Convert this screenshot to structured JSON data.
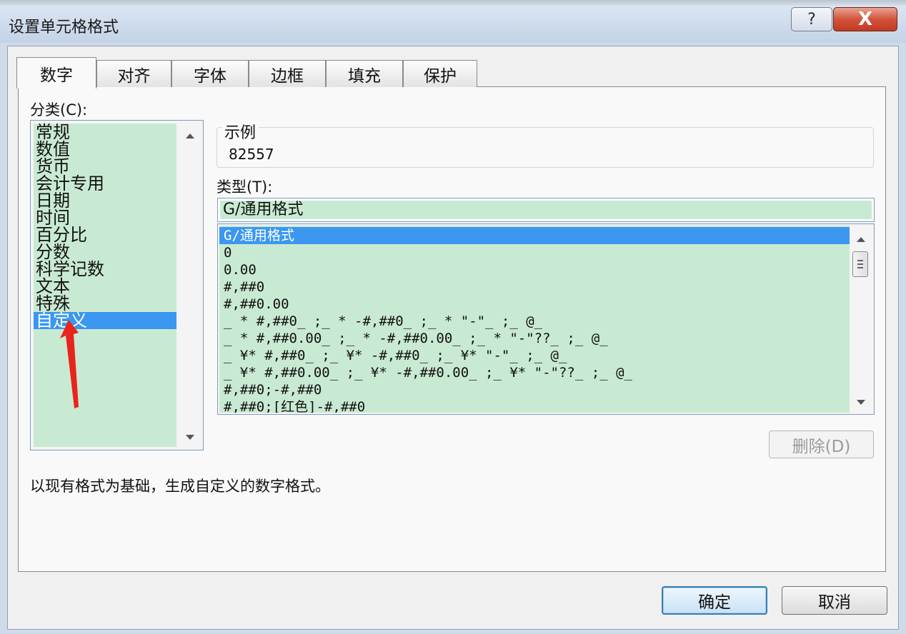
{
  "window": {
    "title": "设置单元格格式",
    "help_label": "?",
    "close_label": "X"
  },
  "tabs": [
    {
      "label": "数字",
      "active": true
    },
    {
      "label": "对齐",
      "active": false
    },
    {
      "label": "字体",
      "active": false
    },
    {
      "label": "边框",
      "active": false
    },
    {
      "label": "填充",
      "active": false
    },
    {
      "label": "保护",
      "active": false
    }
  ],
  "category": {
    "label": "分类(C):",
    "items": [
      "常规",
      "数值",
      "货币",
      "会计专用",
      "日期",
      "时间",
      "百分比",
      "分数",
      "科学记数",
      "文本",
      "特殊",
      "自定义"
    ],
    "selected": "自定义"
  },
  "sample": {
    "legend": "示例",
    "value": "82557"
  },
  "type": {
    "label": "类型(T):",
    "input_value": "G/通用格式",
    "items": [
      "G/通用格式",
      "0",
      "0.00",
      "#,##0",
      "#,##0.00",
      "_ * #,##0_ ;_ * -#,##0_ ;_ * \"-\"_ ;_ @_",
      "_ * #,##0.00_ ;_ * -#,##0.00_ ;_ * \"-\"??_ ;_ @_",
      "_ ¥* #,##0_ ;_ ¥* -#,##0_ ;_ ¥* \"-\"_ ;_ @_",
      "_ ¥* #,##0.00_ ;_ ¥* -#,##0.00_ ;_ ¥* \"-\"??_ ;_ @_",
      "#,##0;-#,##0",
      "#,##0;[红色]-#,##0"
    ],
    "selected": "G/通用格式"
  },
  "delete_button": "删除(D)",
  "description": "以现有格式为基础，生成自定义的数字格式。",
  "ok_button": "确定",
  "cancel_button": "取消",
  "colors": {
    "selection": "#3b97f0",
    "list_bg": "#c9ead2",
    "annotation_arrow": "#e8241c"
  }
}
